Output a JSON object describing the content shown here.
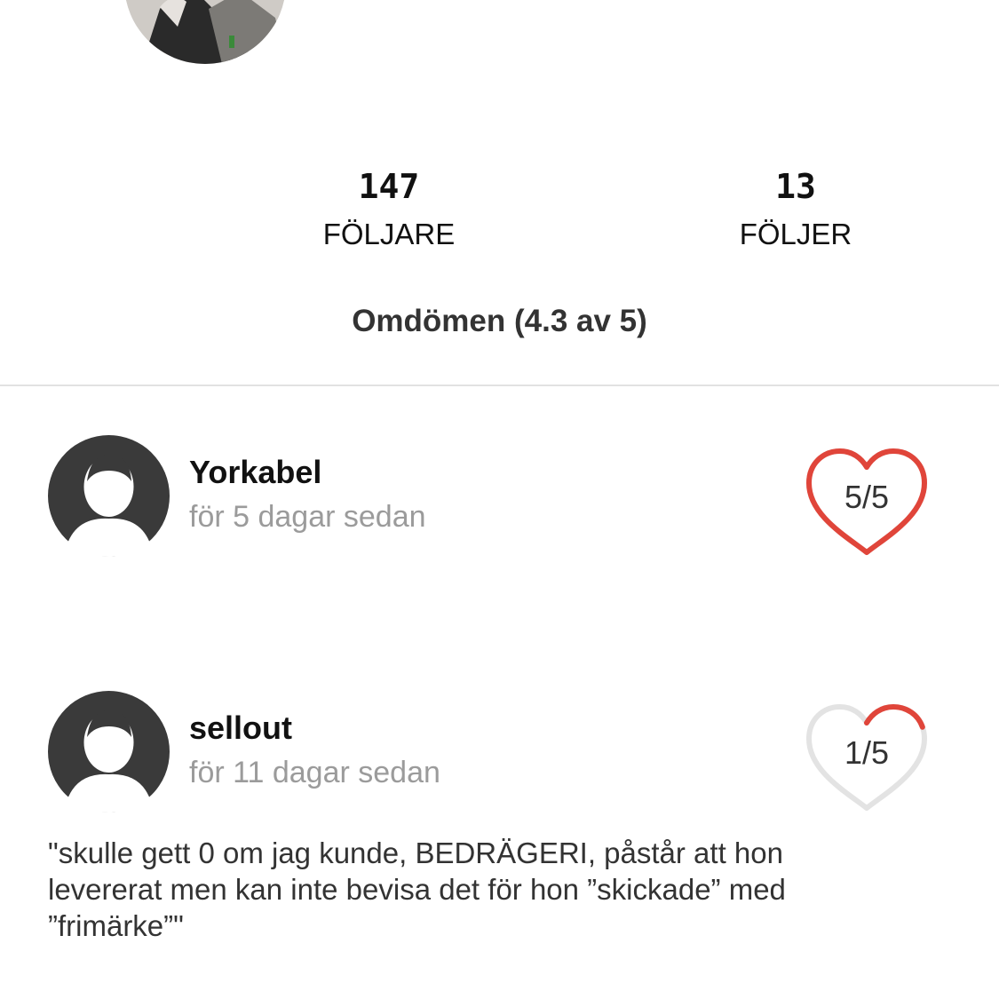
{
  "profile": {
    "followers": {
      "count": "147",
      "label": "FÖLJARE"
    },
    "following": {
      "count": "13",
      "label": "FÖLJER"
    }
  },
  "reviews_title": "Omdömen (4.3 av 5)",
  "reviews": [
    {
      "name": "Yorkabel",
      "time": "för 5 dagar sedan",
      "rating_text": "5/5",
      "rating_value": 5,
      "comment": ""
    },
    {
      "name": "sellout",
      "time": "för 11 dagar sedan",
      "rating_text": "1/5",
      "rating_value": 1,
      "comment": "\"skulle gett 0 om jag kunde, BEDRÄGERI, påstår att hon levererat men kan inte bevisa det för hon ”skickade” med ”frimärke”\""
    }
  ],
  "colors": {
    "heart_filled": "#e0453a",
    "heart_track": "#e3e3e3",
    "avatar_bg": "#3a3a3a",
    "muted_text": "#9b9b9b"
  },
  "icons": {
    "rating": "heart-icon",
    "avatar": "default-avatar-icon"
  }
}
